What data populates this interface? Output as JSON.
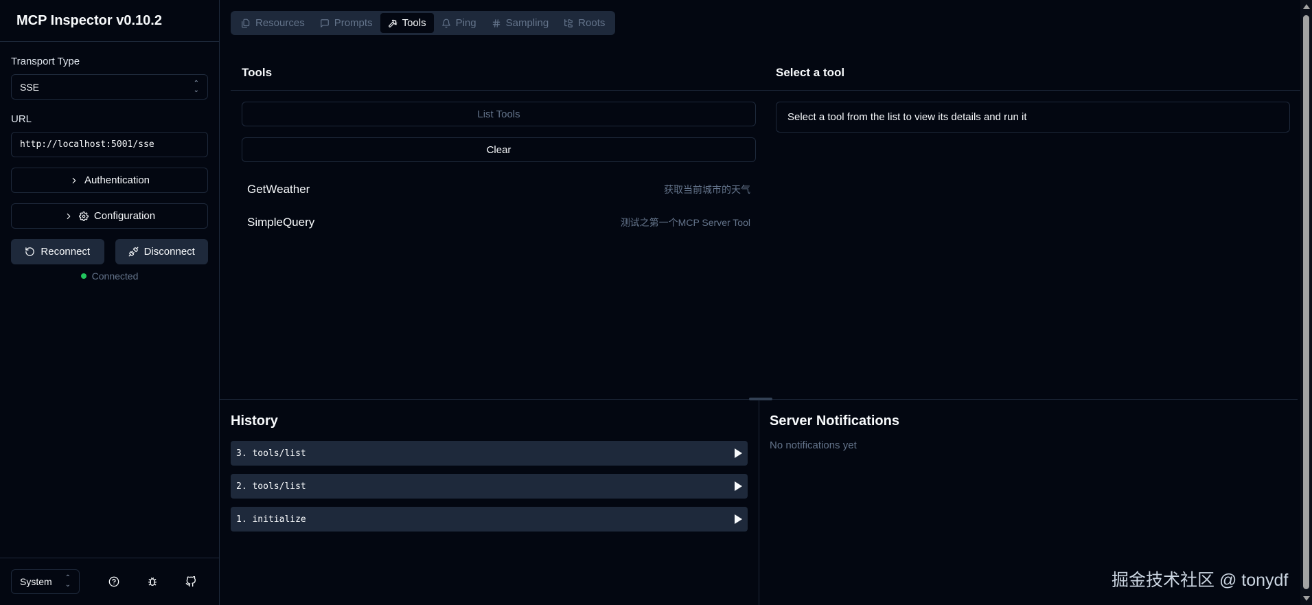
{
  "app": {
    "title": "MCP Inspector v0.10.2"
  },
  "connection": {
    "transport_label": "Transport Type",
    "transport_value": "SSE",
    "url_label": "URL",
    "url_value": "http://localhost:5001/sse",
    "authentication_label": "Authentication",
    "configuration_label": "Configuration",
    "reconnect_label": "Reconnect",
    "disconnect_label": "Disconnect",
    "status_text": "Connected",
    "status_color": "#22c55e"
  },
  "footer": {
    "theme_value": "System"
  },
  "tabs": [
    {
      "label": "Resources",
      "icon": "files-icon",
      "active": false
    },
    {
      "label": "Prompts",
      "icon": "message-square-icon",
      "active": false
    },
    {
      "label": "Tools",
      "icon": "hammer-icon",
      "active": true
    },
    {
      "label": "Ping",
      "icon": "bell-icon",
      "active": false
    },
    {
      "label": "Sampling",
      "icon": "hash-icon",
      "active": false
    },
    {
      "label": "Roots",
      "icon": "folder-tree-icon",
      "active": false
    }
  ],
  "tools_panel": {
    "title": "Tools",
    "list_button": "List Tools",
    "clear_button": "Clear",
    "items": [
      {
        "name": "GetWeather",
        "description": "获取当前城市的天气"
      },
      {
        "name": "SimpleQuery",
        "description": "测试之第一个MCP Server Tool"
      }
    ]
  },
  "detail_panel": {
    "title": "Select a tool",
    "message": "Select a tool from the list to view its details and run it"
  },
  "history": {
    "title": "History",
    "items": [
      {
        "label": "3. tools/list"
      },
      {
        "label": "2. tools/list"
      },
      {
        "label": "1. initialize"
      }
    ]
  },
  "notifications": {
    "title": "Server Notifications",
    "empty_text": "No notifications yet"
  },
  "watermark": "掘金技术社区 @ tonydf"
}
